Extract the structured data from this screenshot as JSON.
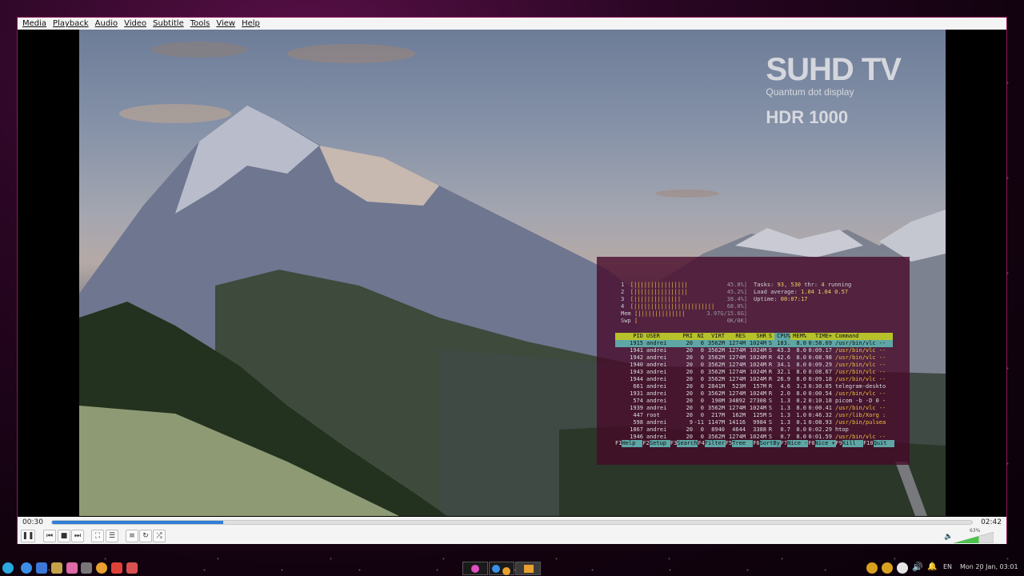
{
  "menubar": {
    "items": [
      "Media",
      "Playback",
      "Audio",
      "Video",
      "Subtitle",
      "Tools",
      "View",
      "Help"
    ]
  },
  "video": {
    "watermark_title": "SUHD TV",
    "watermark_sub": "Quantum dot display",
    "watermark_hdr": "HDR 1000"
  },
  "htop": {
    "meters": [
      {
        "label": "1",
        "bar": "[||||||||||||||||",
        "pct": "45.8%]"
      },
      {
        "label": "2",
        "bar": "[||||||||||||||||",
        "pct": "45.2%]"
      },
      {
        "label": "3",
        "bar": "[||||||||||||||",
        "pct": "38.4%]"
      },
      {
        "label": "4",
        "bar": "[||||||||||||||||||||||||",
        "pct": "68.0%]"
      },
      {
        "label": "Mem",
        "bar": "[||||||||||||||",
        "pct": "3.97G/15.6G]"
      },
      {
        "label": "Swp",
        "bar": "[",
        "pct": "0K/0K]"
      }
    ],
    "tasks_label": "Tasks:",
    "tasks_value": "93, 530",
    "thr_label": "thr:",
    "thr_value": "4",
    "running": "running",
    "load_label": "Load average:",
    "load_value": "1.04 1.04 0.57",
    "uptime_label": "Uptime:",
    "uptime_value": "00:07:17",
    "columns": [
      "PID",
      "USER",
      "PRI",
      "NI",
      "VIRT",
      "RES",
      "SHR",
      "S",
      "CPU%",
      "MEM%",
      "TIME+",
      "Command"
    ],
    "rows": [
      [
        "1915",
        "andrei",
        "20",
        "0",
        "3562M",
        "1274M",
        "1024M",
        "S",
        "183.",
        "8.0",
        "0:58.69",
        "/usr/bin/vlc --"
      ],
      [
        "1941",
        "andrei",
        "20",
        "0",
        "3562M",
        "1274M",
        "1024M",
        "S",
        "43.3",
        "8.0",
        "0:09.17",
        "/usr/bin/vlc --"
      ],
      [
        "1942",
        "andrei",
        "20",
        "0",
        "3562M",
        "1274M",
        "1024M",
        "R",
        "42.6",
        "8.0",
        "0:08.98",
        "/usr/bin/vlc --"
      ],
      [
        "1940",
        "andrei",
        "20",
        "0",
        "3562M",
        "1274M",
        "1024M",
        "R",
        "34.1",
        "8.0",
        "0:09.29",
        "/usr/bin/vlc --"
      ],
      [
        "1943",
        "andrei",
        "20",
        "0",
        "3562M",
        "1274M",
        "1024M",
        "R",
        "32.1",
        "8.0",
        "0:08.67",
        "/usr/bin/vlc --"
      ],
      [
        "1944",
        "andrei",
        "20",
        "0",
        "3562M",
        "1274M",
        "1024M",
        "R",
        "26.9",
        "8.0",
        "0:09.18",
        "/usr/bin/vlc --"
      ],
      [
        "661",
        "andrei",
        "20",
        "0",
        "2841M",
        "523M",
        "157M",
        "R",
        "4.6",
        "3.3",
        "0:30.05",
        "telegram-deskto"
      ],
      [
        "1931",
        "andrei",
        "20",
        "0",
        "3562M",
        "1274M",
        "1024M",
        "R",
        "2.0",
        "8.0",
        "0:00.54",
        "/usr/bin/vlc --"
      ],
      [
        "574",
        "andrei",
        "20",
        "0",
        "190M",
        "34892",
        "27308",
        "S",
        "1.3",
        "0.2",
        "0:10.18",
        "picom -b -D 0 -"
      ],
      [
        "1939",
        "andrei",
        "20",
        "0",
        "3562M",
        "1274M",
        "1024M",
        "S",
        "1.3",
        "8.0",
        "0:00.41",
        "/usr/bin/vlc --"
      ],
      [
        "447",
        "root",
        "20",
        "0",
        "217M",
        "162M",
        "125M",
        "S",
        "1.3",
        "1.0",
        "0:46.32",
        "/usr/lib/Xorg :"
      ],
      [
        "598",
        "andrei",
        "9",
        "-11",
        "1147M",
        "14116",
        "9984",
        "S",
        "1.3",
        "0.1",
        "0:08.93",
        "/usr/bin/pulsea"
      ],
      [
        "1867",
        "andrei",
        "20",
        "0",
        "8940",
        "4644",
        "3388",
        "R",
        "0.7",
        "0.0",
        "0:02.29",
        "htop"
      ],
      [
        "1946",
        "andrei",
        "20",
        "0",
        "3562M",
        "1274M",
        "1024M",
        "S",
        "0.7",
        "8.0",
        "0:01.59",
        "/usr/bin/vlc --"
      ]
    ],
    "fkeys": [
      {
        "key": "F1",
        "label": "Help"
      },
      {
        "key": "F2",
        "label": "Setup"
      },
      {
        "key": "F3",
        "label": "Search"
      },
      {
        "key": "F4",
        "label": "Filter"
      },
      {
        "key": "F5",
        "label": "Tree"
      },
      {
        "key": "F6",
        "label": "SortBy"
      },
      {
        "key": "F7",
        "label": "Nice -"
      },
      {
        "key": "F8",
        "label": "Nice +"
      },
      {
        "key": "F9",
        "label": "Kill"
      },
      {
        "key": "F10",
        "label": "Quit"
      }
    ]
  },
  "controls": {
    "time_current": "00:30",
    "time_total": "02:42",
    "progress_fraction": 0.186,
    "volume_percent_label": "63%",
    "volume_fraction": 0.63,
    "accent_color": "#2f7ed8"
  },
  "taskbar": {
    "lang": "EN",
    "clock": "Mon 20 Jan, 03:01"
  }
}
